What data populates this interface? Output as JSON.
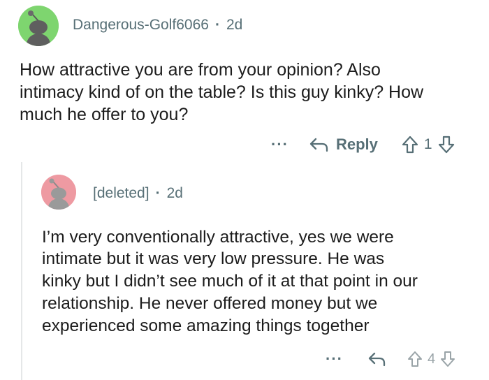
{
  "parent": {
    "username": "Dangerous-Golf6066",
    "separator": "·",
    "age": "2d",
    "avatar_color": "#7ed56f",
    "body_lines": [
      "How attractive you are from your opinion? Also",
      "intimacy kind of on the table? Is this guy kinky? How",
      "much he offer to you?"
    ],
    "actions": {
      "more": "···",
      "reply_label": "Reply",
      "score": "1"
    }
  },
  "reply": {
    "username": "[deleted]",
    "separator": "·",
    "age": "2d",
    "avatar_color": "#ee9aa2",
    "body_lines": [
      "I’m very conventionally attractive, yes we were",
      "intimate but it was very low pressure. He was",
      "kinky but I didn’t see much of it at that point in our",
      "relationship. He never offered money but we",
      "experienced some amazing things together"
    ],
    "actions": {
      "more": "···",
      "score": "4"
    }
  },
  "colors": {
    "meta_text": "#576f76",
    "body_text": "#1c1c1c",
    "thread_line": "#e5e7e8"
  },
  "icons": [
    "snoo-avatar-icon",
    "more-options-icon",
    "reply-arrow-icon",
    "upvote-arrow-icon",
    "downvote-arrow-icon"
  ]
}
